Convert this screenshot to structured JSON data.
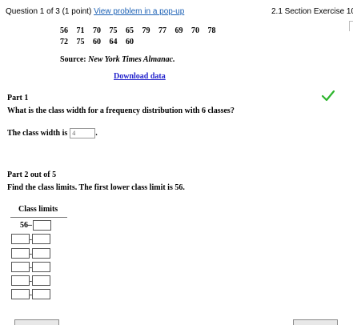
{
  "header": {
    "question_info": "Question 1 of 3 (1 point)",
    "popup_link": "View problem in a pop-up",
    "section": "2.1 Section Exercise 10"
  },
  "dataset": {
    "row1": "56 71 70 75 65 79 77 69 70 78",
    "row2": "72 75 60 64 60",
    "source_label": "Source:",
    "source_name": "New York Times Almanac.",
    "download": "Download data"
  },
  "part1": {
    "title": "Part 1",
    "question": "What is the class width for a frequency distribution with 6 classes?",
    "answer_prefix": "The class width is",
    "answer_value": "4",
    "answer_suffix": ".",
    "status": "correct",
    "status_color": "#2db52d"
  },
  "part2": {
    "title": "Part 2 out of 5",
    "question": "Find the class limits. The first lower class limit is 56.",
    "table_header": "Class limits",
    "first_lower": "56",
    "first_separator": "–",
    "separator": "-"
  }
}
